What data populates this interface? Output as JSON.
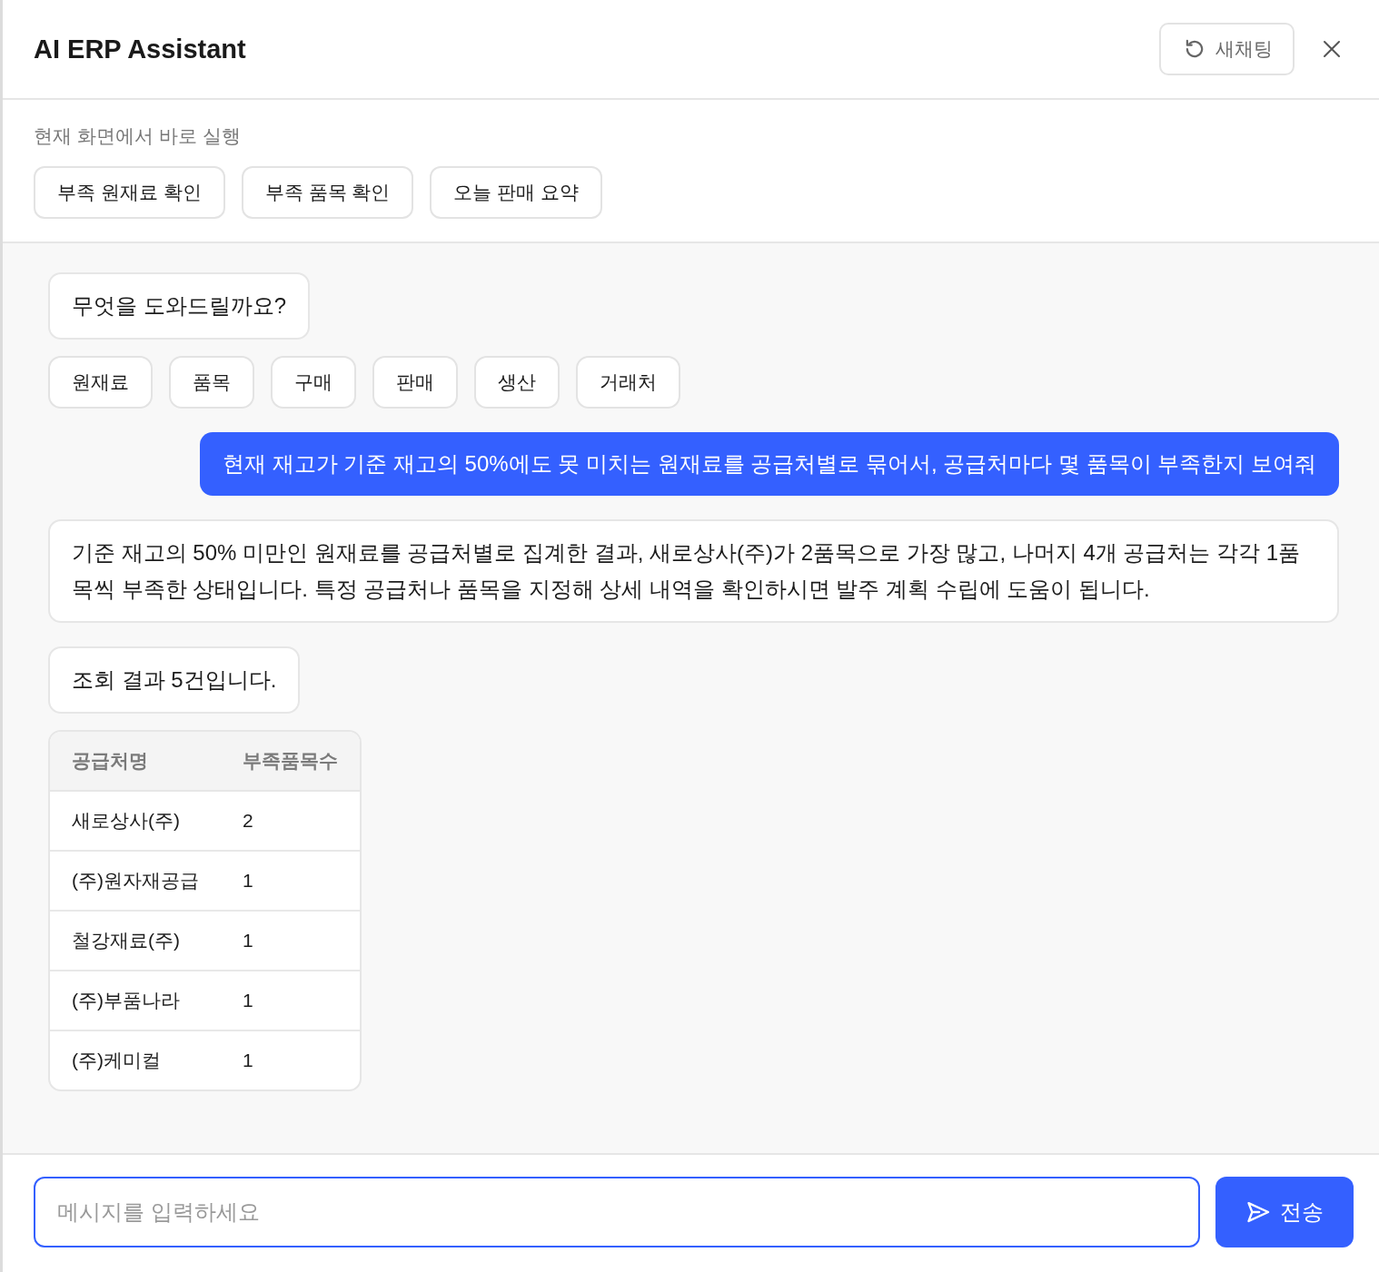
{
  "header": {
    "title": "AI ERP Assistant",
    "new_chat_button": "새채팅"
  },
  "quick_actions": {
    "label": "현재 화면에서 바로 실행",
    "buttons": [
      "부족 원재료 확인",
      "부족 품목 확인",
      "오늘 판매 요약"
    ]
  },
  "messages": [
    {
      "kind": "assistant",
      "text": "무엇을 도와드릴까요?",
      "chips": [
        "원재료",
        "품목",
        "구매",
        "판매",
        "생산",
        "거래처"
      ]
    },
    {
      "kind": "user",
      "text": "현재 재고가 기준 재고의 50%에도 못 미치는 원재료를 공급처별로 묶어서, 공급처마다 몇 품목이 부족한지 보여줘"
    },
    {
      "kind": "assistant",
      "text": "기준 재고의 50% 미만인 원재료를 공급처별로 집계한 결과, 새로상사(주)가 2품목으로 가장 많고, 나머지 4개 공급처는 각각 1품목씩 부족한 상태입니다. 특정 공급처나 품목을 지정해 상세 내역을 확인하시면 발주 계획 수립에 도움이 됩니다."
    },
    {
      "kind": "assistant",
      "text": "조회 결과 5건입니다.",
      "table": {
        "columns": [
          "공급처명",
          "부족품목수"
        ],
        "rows": [
          [
            "새로상사(주)",
            "2"
          ],
          [
            "(주)원자재공급",
            "1"
          ],
          [
            "철강재료(주)",
            "1"
          ],
          [
            "(주)부품나라",
            "1"
          ],
          [
            "(주)케미컬",
            "1"
          ]
        ]
      }
    }
  ],
  "composer": {
    "placeholder": "메시지를 입력하세요",
    "send_button": "전송"
  }
}
